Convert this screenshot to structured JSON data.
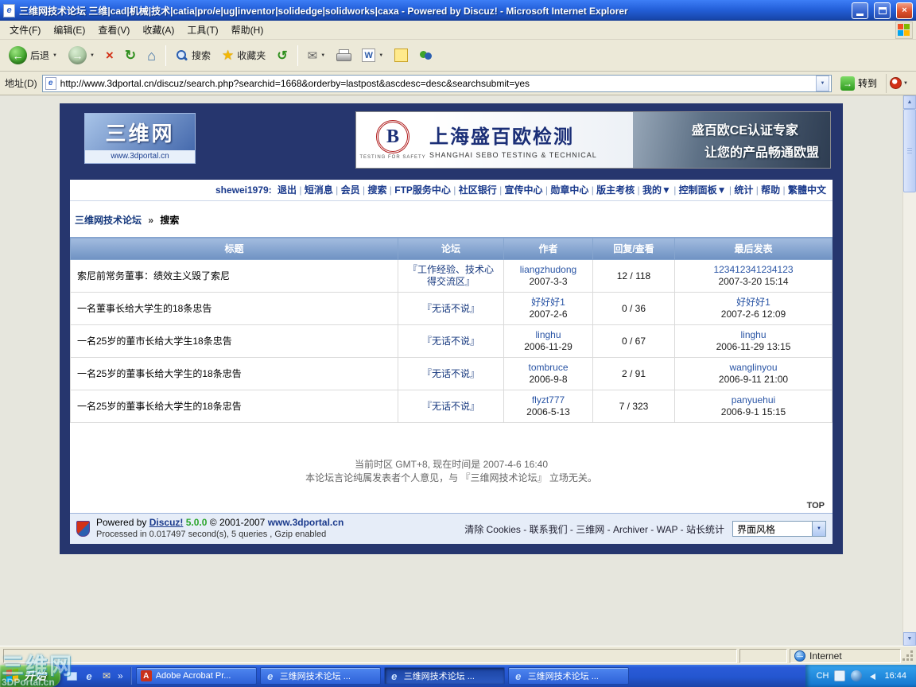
{
  "window": {
    "title": "三维网技术论坛 三维|cad|机械|技术|catia|pro/e|ug|inventor|solidedge|solidworks|caxa - Powered by Discuz! - Microsoft Internet Explorer",
    "menu_items": [
      "文件(F)",
      "编辑(E)",
      "查看(V)",
      "收藏(A)",
      "工具(T)",
      "帮助(H)"
    ],
    "toolbar": {
      "back": "后退",
      "search": "搜索",
      "favorites": "收藏夹"
    },
    "address": {
      "label": "地址(D)",
      "url": "http://www.3dportal.cn/discuz/search.php?searchid=1668&orderby=lastpost&ascdesc=desc&searchsubmit=yes",
      "go": "转到"
    },
    "status_zone": "Internet"
  },
  "icons": {
    "back_arrow": "←",
    "forward_arrow": "→",
    "stop": "×",
    "refresh": "↻",
    "home": "⌂",
    "star": "★",
    "history": "↺",
    "mail": "✉",
    "word": "W",
    "ie": "e",
    "adobe": "A",
    "dropdown": "▼",
    "chevron": "»",
    "close": "×",
    "up_arrow": "▲",
    "down_arrow": "▼",
    "go_arrow": "→"
  },
  "page": {
    "logo": {
      "title": "三维网",
      "subtitle": "www.3dportal.cn"
    },
    "banner": {
      "b": "B",
      "tagline": "TESTING FOR SAFETY",
      "company_cn": "上海盛百欧检测",
      "company_en": "SHANGHAI SEBO TESTING & TECHNICAL",
      "slogan1": "盛百欧CE认证专家",
      "slogan2": "让您的产品畅通欧盟"
    },
    "nav": {
      "user": "shewei1979:",
      "items": [
        "退出",
        "短消息",
        "会员",
        "搜索",
        "FTP服务中心",
        "社区银行",
        "宣传中心",
        "勋章中心",
        "版主考核",
        "我的▼",
        "控制面板▼",
        "统计",
        "帮助",
        "繁體中文"
      ]
    },
    "breadcrumb": {
      "root": "三维网技术论坛",
      "sep": "»",
      "current": "搜索"
    },
    "table": {
      "headers": [
        "标题",
        "论坛",
        "作者",
        "回复/查看",
        "最后发表"
      ],
      "rows": [
        {
          "title": "索尼前常务董事：绩效主义毁了索尼",
          "forum": "『工作经验、技术心得交流区』",
          "author": "liangzhudong",
          "author_date": "2007-3-3",
          "replies": "12 / 118",
          "last_user": "123412341234123",
          "last_date": "2007-3-20 15:14"
        },
        {
          "title": "一名董事长给大学生的18条忠告",
          "forum": "『无话不说』",
          "author": "好好好1",
          "author_date": "2007-2-6",
          "replies": "0 / 36",
          "last_user": "好好好1",
          "last_date": "2007-2-6 12:09"
        },
        {
          "title": "一名25岁的董市长给大学生18条忠告",
          "forum": "『无话不说』",
          "author": "linghu",
          "author_date": "2006-11-29",
          "replies": "0 / 67",
          "last_user": "linghu",
          "last_date": "2006-11-29 13:15"
        },
        {
          "title": "一名25岁的董事长给大学生的18条忠告",
          "forum": "『无话不说』",
          "author": "tombruce",
          "author_date": "2006-9-8",
          "replies": "2 / 91",
          "last_user": "wanglinyou",
          "last_date": "2006-9-11 21:00"
        },
        {
          "title": "一名25岁的董事长给大学生的18条忠告",
          "forum": "『无话不说』",
          "author": "flyzt777",
          "author_date": "2006-5-13",
          "replies": "7 / 323",
          "last_user": "panyuehui",
          "last_date": "2006-9-1 15:15"
        }
      ]
    },
    "footer": {
      "timezone": "当前时区 GMT+8, 现在时间是 2007-4-6 16:40",
      "disclaimer": "本论坛言论纯属发表者个人意见，与 『三维网技术论坛』 立场无关。",
      "top": "TOP",
      "powered_prefix": "Powered by",
      "powered_brand": "Discuz!",
      "powered_version": "5.0.0",
      "powered_copy": "© 2001-2007",
      "powered_site": "www.3dportal.cn",
      "processed": "Processed in 0.017497 second(s), 5 queries , Gzip enabled",
      "links": [
        "清除 Cookies",
        "联系我们",
        "三维网",
        "Archiver",
        "WAP",
        "站长统计"
      ],
      "style_label": "界面风格"
    }
  },
  "taskbar": {
    "start": "开始",
    "tasks": [
      {
        "label": "Adobe Acrobat Pr...",
        "active": false
      },
      {
        "label": "三维网技术论坛 ...",
        "active": false
      },
      {
        "label": "三维网技术论坛 ...",
        "active": true
      },
      {
        "label": "三维网技术论坛 ...",
        "active": false
      }
    ],
    "tray": {
      "lang": "CH",
      "time": "16:44"
    }
  },
  "watermark": {
    "title": "三维网",
    "subtitle": "3DPortal.cn"
  },
  "colors": {
    "titlebar_blue": "#2E6BE4",
    "wrapper_navy": "#26366E",
    "table_header_blue": "#7C9CCB",
    "taskbar_blue": "#2456D0",
    "start_green": "#46A032",
    "link_blue": "#1A3A8C",
    "version_green": "#2BA52B"
  }
}
